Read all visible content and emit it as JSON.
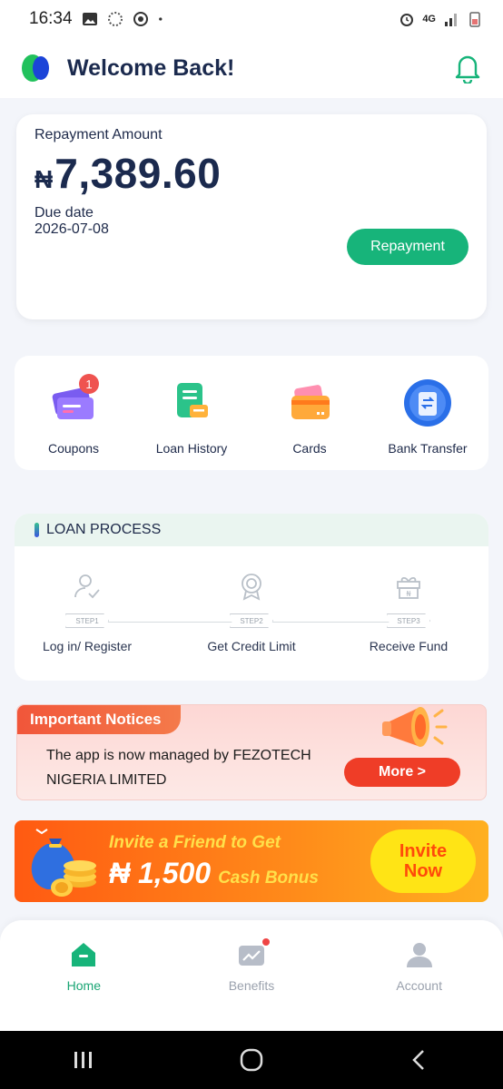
{
  "status_bar": {
    "time": "16:34",
    "network": "4G",
    "icons": [
      "gallery-icon",
      "sync-icon",
      "target-icon",
      "dot-icon",
      "alarm-icon",
      "signal-icon",
      "battery-icon"
    ]
  },
  "header": {
    "title": "Welcome Back!",
    "icons": [
      "app-logo",
      "bell-icon"
    ]
  },
  "repayment": {
    "label": "Repayment Amount",
    "currency": "₦",
    "amount": "7,389.60",
    "due_label": "Due date",
    "due_date": "2026-07-08",
    "button": "Repayment"
  },
  "actions": [
    {
      "label": "Coupons",
      "icon": "coupon-icon",
      "badge": "1"
    },
    {
      "label": "Loan History",
      "icon": "loan-history-icon"
    },
    {
      "label": "Cards",
      "icon": "cards-icon"
    },
    {
      "label": "Bank Transfer",
      "icon": "bank-transfer-icon"
    }
  ],
  "loan_process": {
    "title": "LOAN PROCESS",
    "steps": [
      {
        "tag": "STEP1",
        "label": "Log in/ Register",
        "icon": "user-check-icon"
      },
      {
        "tag": "STEP2",
        "label": "Get Credit Limit",
        "icon": "award-icon"
      },
      {
        "tag": "STEP3",
        "label": "Receive Fund",
        "icon": "gift-icon"
      }
    ]
  },
  "notice": {
    "tag": "Important Notices",
    "text": "The app is now managed by FEZOTECH NIGERIA LIMITED",
    "button": "More >"
  },
  "invite": {
    "line1": "Invite a Friend to Get",
    "amount": "₦ 1,500",
    "bonus": "Cash Bonus",
    "button_line1": "Invite",
    "button_line2": "Now"
  },
  "bottom_nav": [
    {
      "label": "Home",
      "icon": "home-icon",
      "active": true
    },
    {
      "label": "Benefits",
      "icon": "benefits-icon",
      "active": false
    },
    {
      "label": "Account",
      "icon": "account-icon",
      "active": false
    }
  ],
  "colors": {
    "primary_green": "#17b47a",
    "navy": "#1b2a4e",
    "notice_red": "#ef3d27",
    "invite_orange": "#ff6a14"
  }
}
